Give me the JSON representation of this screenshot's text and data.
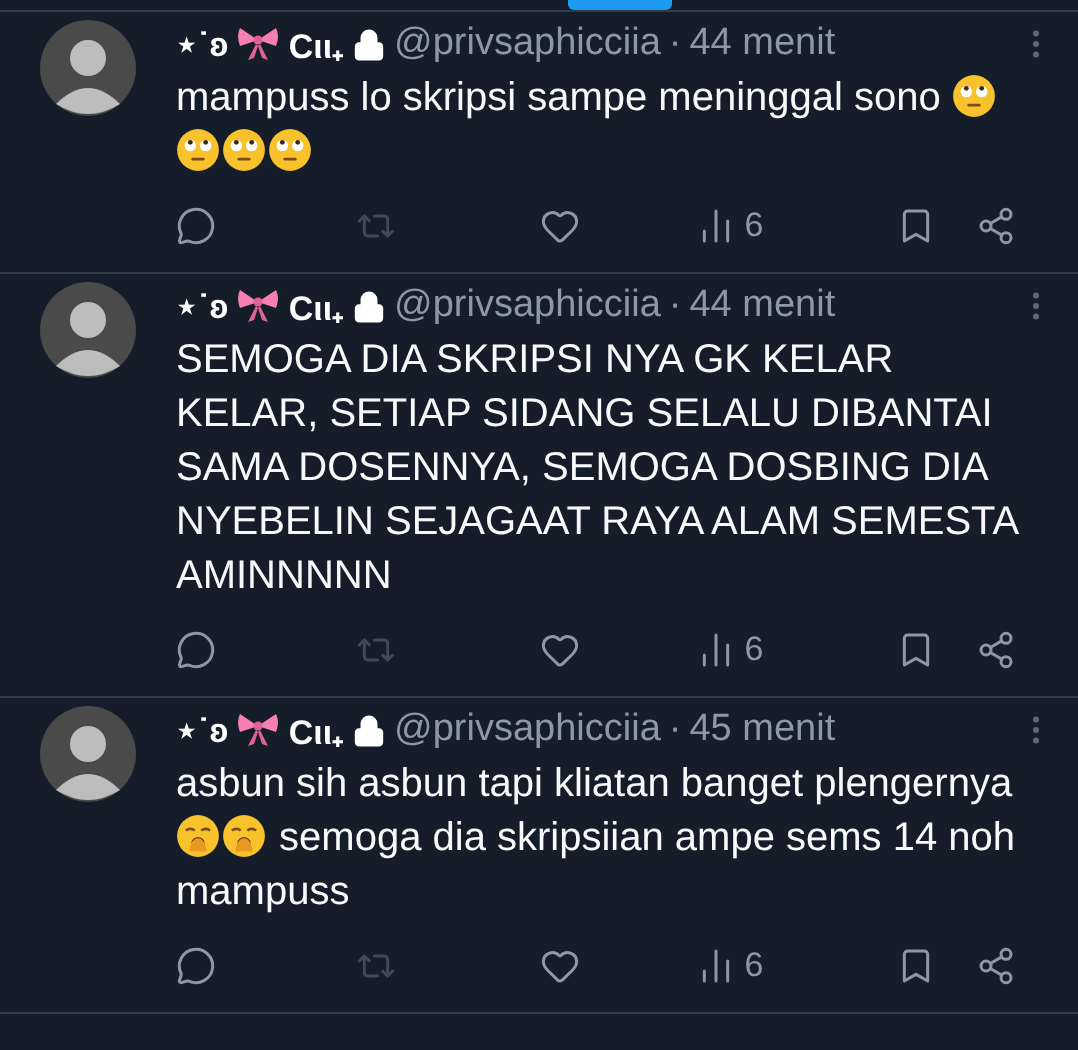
{
  "tweets": [
    {
      "name_before": "⋆˙ʚ",
      "name_after": "Cιι₊",
      "locked": true,
      "handle": "@privsaphicciia",
      "separator": "·",
      "time": "44 menit",
      "body": [
        {
          "kind": "text",
          "text": "mampuss lo skripsi sampe meninggal sono "
        },
        {
          "kind": "rolling-eyes"
        },
        {
          "kind": "rolling-eyes"
        },
        {
          "kind": "rolling-eyes"
        },
        {
          "kind": "rolling-eyes"
        }
      ],
      "actions": [
        {
          "kind": "reply",
          "disabled": false
        },
        {
          "kind": "repost",
          "disabled": true
        },
        {
          "kind": "like",
          "disabled": false
        },
        {
          "kind": "views",
          "disabled": false,
          "count": "6"
        },
        {
          "kind": "bookmark",
          "disabled": false
        },
        {
          "kind": "share",
          "disabled": false
        }
      ]
    },
    {
      "name_before": "⋆˙ʚ",
      "name_after": "Cιι₊",
      "locked": true,
      "handle": "@privsaphicciia",
      "separator": "·",
      "time": "44 menit",
      "body": [
        {
          "kind": "text",
          "text": "SEMOGA DIA SKRIPSI NYA GK KELAR KELAR, SETIAP SIDANG SELALU DIBANTAI SAMA DOSENNYA, SEMOGA DOSBING DIA NYEBELIN SEJAGAAT RAYA ALAM SEMESTA AMINNNNN"
        }
      ],
      "actions": [
        {
          "kind": "reply",
          "disabled": false
        },
        {
          "kind": "repost",
          "disabled": true
        },
        {
          "kind": "like",
          "disabled": false
        },
        {
          "kind": "views",
          "disabled": false,
          "count": "6"
        },
        {
          "kind": "bookmark",
          "disabled": false
        },
        {
          "kind": "share",
          "disabled": false
        }
      ]
    },
    {
      "name_before": "⋆˙ʚ",
      "name_after": "Cιι₊",
      "locked": true,
      "handle": "@privsaphicciia",
      "separator": "·",
      "time": "45 menit",
      "body": [
        {
          "kind": "text",
          "text": "asbun sih asbun tapi kliatan banget plengernya "
        },
        {
          "kind": "yawning"
        },
        {
          "kind": "yawning"
        },
        {
          "kind": "text",
          "text": " semoga dia skripsiian ampe sems 14 noh mampuss"
        }
      ],
      "actions": [
        {
          "kind": "reply",
          "disabled": false
        },
        {
          "kind": "repost",
          "disabled": true
        },
        {
          "kind": "like",
          "disabled": false
        },
        {
          "kind": "views",
          "disabled": false,
          "count": "6"
        },
        {
          "kind": "bookmark",
          "disabled": false
        },
        {
          "kind": "share",
          "disabled": false
        }
      ]
    }
  ]
}
